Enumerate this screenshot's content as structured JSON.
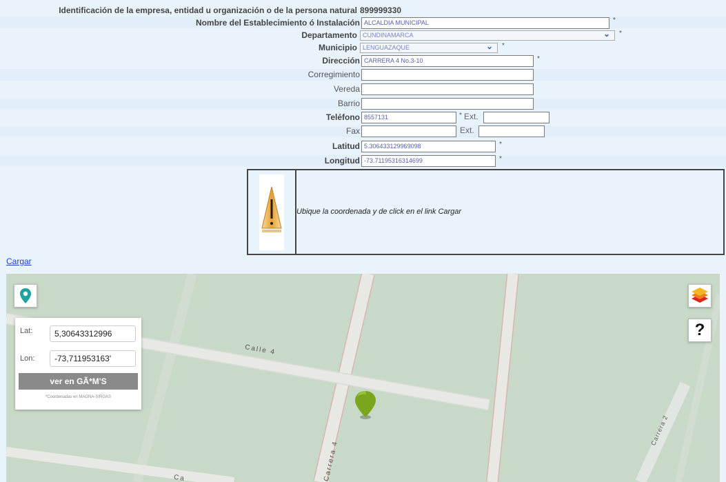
{
  "form": {
    "identificacion": {
      "label": "Identificación de la empresa, entidad u organización o de la persona natural",
      "value": "899999330"
    },
    "nombre": {
      "label": "Nombre del Establecimiento ó Instalación",
      "value": "ALCALDIA MUNICIPAL",
      "required": "*"
    },
    "departamento": {
      "label": "Departamento",
      "value": "CUNDINAMARCA",
      "required": "*"
    },
    "municipio": {
      "label": "Municipio",
      "value": "LENGUAZAQUE",
      "required": "*"
    },
    "direccion": {
      "label": "Dirección",
      "value": "CARRERA 4 No.3-10",
      "required": "*"
    },
    "corregimiento": {
      "label": "Corregimiento",
      "value": ""
    },
    "vereda": {
      "label": "Vereda",
      "value": ""
    },
    "barrio": {
      "label": "Barrio",
      "value": ""
    },
    "telefono": {
      "label": "Teléfono",
      "value": "8557131",
      "required": "*",
      "ext_label": "Ext.",
      "ext_value": ""
    },
    "fax": {
      "label": "Fax",
      "value": "",
      "ext_label": "Ext.",
      "ext_value": ""
    },
    "latitud": {
      "label": "Latitud",
      "value": "5.306433129969098",
      "required": "*"
    },
    "longitud": {
      "label": "Longitud",
      "value": "-73.711953163146​99",
      "required": "*"
    }
  },
  "notice": {
    "message": "Ubique la coordenada y de click en el link Cargar",
    "icon": "warning-icon"
  },
  "cargar_link": "Cargar",
  "map": {
    "street_labels": [
      "Calle 4",
      "Carrera 4",
      "Carrera 2",
      "Ca"
    ],
    "coord_panel": {
      "lat_label": "Lat:",
      "lat_value": "5,30643312996",
      "lon_label": "Lon:",
      "lon_value": "-73,711953163'",
      "button_label": "ver en GÃ*M'S",
      "note": "*Coordenadas en MAGNA-SIRGAS"
    },
    "buttons": {
      "locate_icon": "map-pin-icon",
      "layers_icon": "layers-icon",
      "help_label": "?"
    },
    "marker_icon": "marker-icon",
    "colors": {
      "background": "#c9d9c7",
      "road": "#e8e8e4",
      "road_edge": "#d9b5b0",
      "marker": "#7aa61e"
    }
  }
}
